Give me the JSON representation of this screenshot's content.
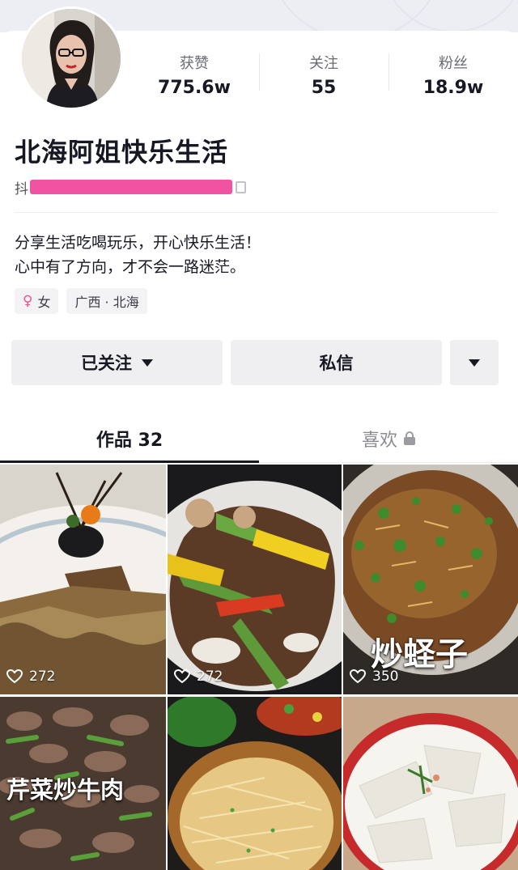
{
  "profile": {
    "nickname": "北海阿姐快乐生活",
    "douyin_id_prefix": "抖",
    "bio_line1": "分享生活吃喝玩乐，开心快乐生活！",
    "bio_line2": "心中有了方向，才不会一路迷茫。",
    "gender_icon": "female-icon",
    "gender_label": "女",
    "location": "广西 · 北海"
  },
  "stats": [
    {
      "label": "获赞",
      "value": "775.6w"
    },
    {
      "label": "关注",
      "value": "55"
    },
    {
      "label": "粉丝",
      "value": "18.9w"
    }
  ],
  "actions": {
    "followed_label": "已关注",
    "message_label": "私信"
  },
  "tabs": {
    "works_label": "作品 32",
    "likes_label": "喜欢"
  },
  "videos": [
    {
      "likes": "272",
      "title": ""
    },
    {
      "likes": "272",
      "title": ""
    },
    {
      "likes": "350",
      "title": "炒蛏子"
    },
    {
      "likes": "",
      "title": "芹菜炒牛肉"
    },
    {
      "likes": "",
      "title": ""
    },
    {
      "likes": "",
      "title": ""
    }
  ],
  "colors": {
    "text_primary": "#161823",
    "button_bg": "#efeff1",
    "redaction": "#f0449b",
    "female": "#f2528f"
  }
}
